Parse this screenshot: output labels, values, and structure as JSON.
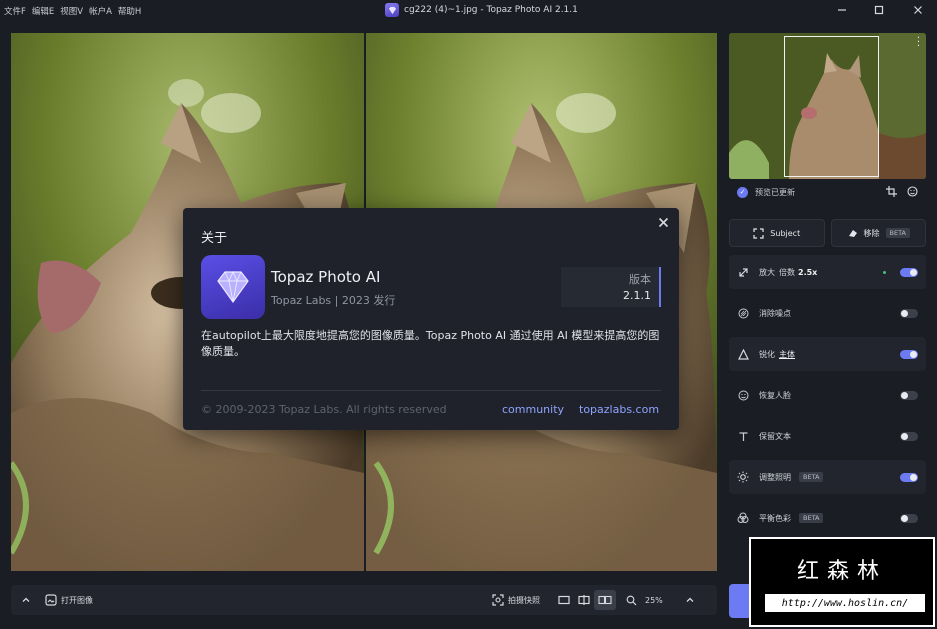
{
  "menu": [
    "文件F",
    "编辑E",
    "视图V",
    "帐户A",
    "帮助H"
  ],
  "window": {
    "title": "cg222 (4)~1.jpg - Topaz Photo AI 2.1.1"
  },
  "bottombar": {
    "open_image": "打开图像",
    "snapshot": "拍摄快照",
    "zoom": "25%"
  },
  "sidebar": {
    "preview_status": "预览已更新",
    "subject_label": "Subject",
    "remove_label": "移除",
    "beta": "BETA",
    "features": [
      {
        "label": "放大",
        "extra": "倍数",
        "value": "2.5x",
        "on": true
      },
      {
        "label": "消除噪点",
        "on": false
      },
      {
        "label": "锐化",
        "extra": "主体",
        "on": true
      },
      {
        "label": "恢复人脸",
        "on": false
      },
      {
        "label": "保留文本",
        "on": false
      },
      {
        "label": "调整照明",
        "beta": "BETA",
        "on": true
      },
      {
        "label": "平衡色彩",
        "beta": "BETA",
        "on": false
      }
    ]
  },
  "dialog": {
    "title": "关于",
    "app_name": "Topaz Photo AI",
    "publisher": "Topaz Labs | 2023 发行",
    "version_label": "版本",
    "version": "2.1.1",
    "description": "在autopilot上最大限度地提高您的图像质量。Topaz Photo AI 通过使用 AI 模型来提高您的图像质量。",
    "copyright": "© 2009-2023 Topaz Labs. All rights reserved",
    "link_community": "community",
    "link_site": "topazlabs.com"
  },
  "watermark": {
    "text": "红森林",
    "url": "http://www.hoslin.cn/"
  },
  "colors": {
    "accent": "#6c7bf2",
    "background": "#1b1d24",
    "panel": "#22252d"
  }
}
